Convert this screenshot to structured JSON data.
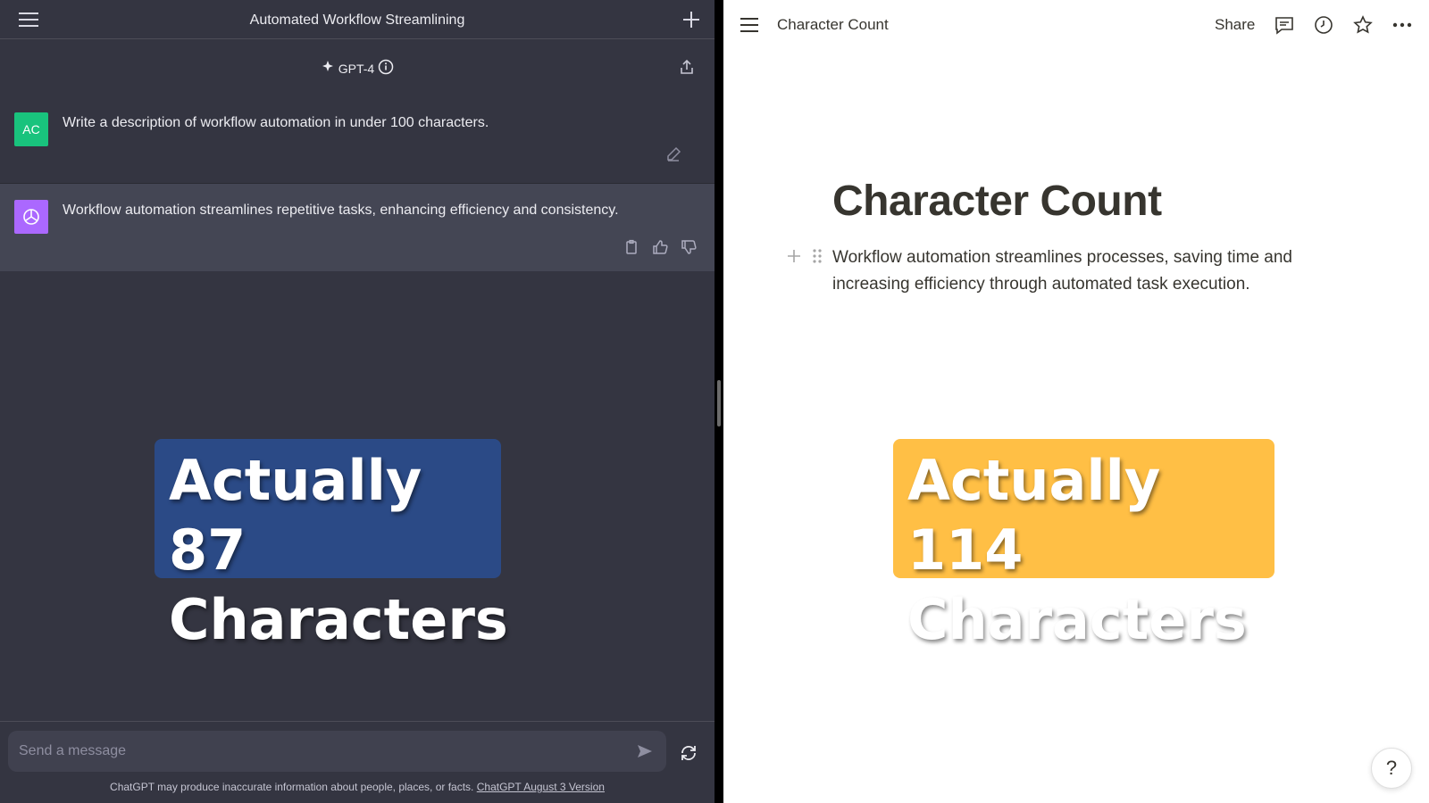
{
  "left": {
    "header_title": "Automated Workflow Streamlining",
    "model_label": "GPT-4",
    "messages": [
      {
        "avatar": "AC",
        "text": "Write a description of workflow automation in under 100 characters."
      },
      {
        "avatar": "",
        "text": "Workflow automation streamlines repetitive tasks, enhancing efficiency and consistency."
      }
    ],
    "composer_placeholder": "Send a message",
    "footer_text": "ChatGPT may produce inaccurate information about people, places, or facts.",
    "footer_link": "ChatGPT August 3 Version",
    "overlay": {
      "line1": "Actually 87",
      "line2": "Characters",
      "color": "#2b4a86"
    }
  },
  "right": {
    "breadcrumb": "Character Count",
    "share_label": "Share",
    "page_title": "Character Count",
    "block_text": "Workflow automation streamlines processes, saving time and increasing efficiency through automated task execution.",
    "help_label": "?",
    "overlay": {
      "line1": "Actually 114",
      "line2": "Characters",
      "color": "#ffbf45"
    }
  },
  "icons": {
    "menu": "menu-icon",
    "plus": "plus-icon",
    "share": "share-icon",
    "info": "info-icon",
    "sparkle": "sparkle-icon",
    "edit": "edit-icon",
    "copy": "copy-icon",
    "thumbs_up": "thumbs-up-icon",
    "thumbs_down": "thumbs-down-icon",
    "send": "send-icon",
    "regenerate": "regenerate-icon",
    "comment": "comment-icon",
    "clock": "clock-icon",
    "star": "star-icon",
    "more": "more-icon",
    "drag": "drag-handle-icon"
  }
}
